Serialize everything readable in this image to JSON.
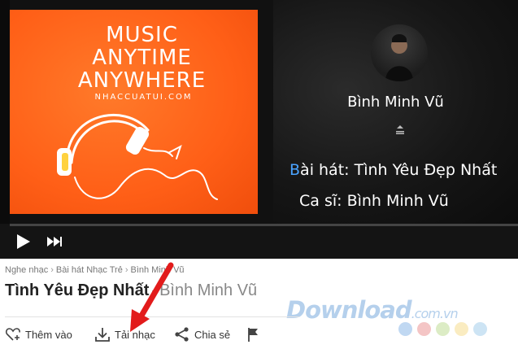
{
  "player": {
    "artwork": {
      "line1": "MUSIC",
      "line2": "ANYTIME",
      "line3": "ANYWHERE",
      "site": "NHACCUATUI.COM"
    },
    "singer_name": "Bình Minh Vũ",
    "lyrics_song_first": "B",
    "lyrics_song_rest": "ài hát: Tình Yêu Đẹp Nhất",
    "lyrics_singer": "Ca sĩ: Bình Minh Vũ",
    "controls": {
      "play_icon": "play-icon",
      "next_icon": "next-icon"
    }
  },
  "breadcrumb": [
    "Nghe nhạc",
    "Bài hát Nhạc Trẻ",
    "Bình Minh Vũ"
  ],
  "song": {
    "title": "Tình Yêu Đẹp Nhất",
    "separator": "-",
    "artist": "Bình Minh Vũ"
  },
  "actions": {
    "add_label": "Thêm vào",
    "download_label": "Tải nhạc",
    "share_label": "Chia sẻ"
  },
  "watermark": {
    "name": "Download",
    "tld": ".com.vn"
  },
  "colors": {
    "artwork_orange": "#ff5f17",
    "arrow_red": "#e21b1b",
    "lyric_highlight": "#4aa3ff"
  }
}
